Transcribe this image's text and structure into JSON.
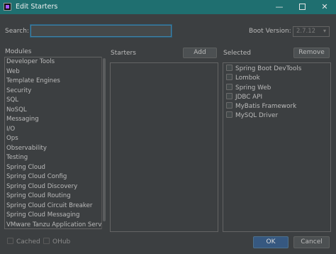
{
  "window": {
    "title": "Edit Starters",
    "minimize_glyph": "—",
    "close_glyph": "✕"
  },
  "search": {
    "label": "Search:",
    "value": "",
    "placeholder": ""
  },
  "boot_version": {
    "label": "Boot Version:",
    "selected": "2.7.12"
  },
  "modules": {
    "header": "Modules",
    "items": [
      "Developer Tools",
      "Web",
      "Template Engines",
      "Security",
      "SQL",
      "NoSQL",
      "Messaging",
      "I/O",
      "Ops",
      "Observability",
      "Testing",
      "Spring Cloud",
      "Spring Cloud Config",
      "Spring Cloud Discovery",
      "Spring Cloud Routing",
      "Spring Cloud Circuit Breaker",
      "Spring Cloud Messaging",
      "VMware Tanzu Application Service"
    ]
  },
  "starters": {
    "header": "Starters",
    "add_label": "Add"
  },
  "selected": {
    "header": "Selected",
    "remove_label": "Remove",
    "items": [
      "Spring Boot DevTools",
      "Lombok",
      "Spring Web",
      "JDBC API",
      "MyBatis Framework",
      "MySQL Driver"
    ]
  },
  "footer": {
    "cached_label": "Cached",
    "ohub_label": "OHub",
    "ok_label": "OK",
    "cancel_label": "Cancel"
  }
}
